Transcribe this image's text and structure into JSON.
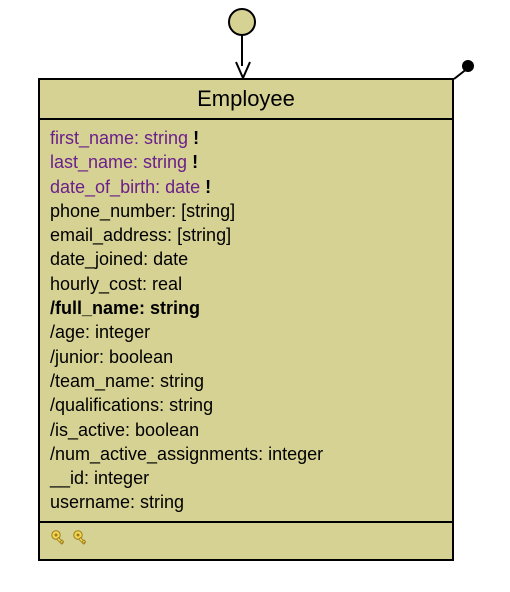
{
  "entity": {
    "name": "Employee",
    "attributes": [
      {
        "label": "first_name: string",
        "pk": true,
        "mandatory": true,
        "bold": false
      },
      {
        "label": "last_name: string",
        "pk": true,
        "mandatory": true,
        "bold": false
      },
      {
        "label": "date_of_birth: date",
        "pk": true,
        "mandatory": true,
        "bold": false
      },
      {
        "label": "phone_number: [string]",
        "pk": false,
        "mandatory": false,
        "bold": false
      },
      {
        "label": "email_address: [string]",
        "pk": false,
        "mandatory": false,
        "bold": false
      },
      {
        "label": "date_joined: date",
        "pk": false,
        "mandatory": false,
        "bold": false
      },
      {
        "label": "hourly_cost: real",
        "pk": false,
        "mandatory": false,
        "bold": false
      },
      {
        "label": "/full_name: string",
        "pk": false,
        "mandatory": false,
        "bold": true
      },
      {
        "label": "/age: integer",
        "pk": false,
        "mandatory": false,
        "bold": false
      },
      {
        "label": "/junior: boolean",
        "pk": false,
        "mandatory": false,
        "bold": false
      },
      {
        "label": "/team_name: string",
        "pk": false,
        "mandatory": false,
        "bold": false
      },
      {
        "label": "/qualifications: string",
        "pk": false,
        "mandatory": false,
        "bold": false
      },
      {
        "label": "/is_active: boolean",
        "pk": false,
        "mandatory": false,
        "bold": false
      },
      {
        "label": "/num_active_assignments: integer",
        "pk": false,
        "mandatory": false,
        "bold": false
      },
      {
        "label": "__id: integer",
        "pk": false,
        "mandatory": false,
        "bold": false
      },
      {
        "label": "username: string",
        "pk": false,
        "mandatory": false,
        "bold": false
      }
    ],
    "keys": 2,
    "mandatory_marker": " !"
  }
}
